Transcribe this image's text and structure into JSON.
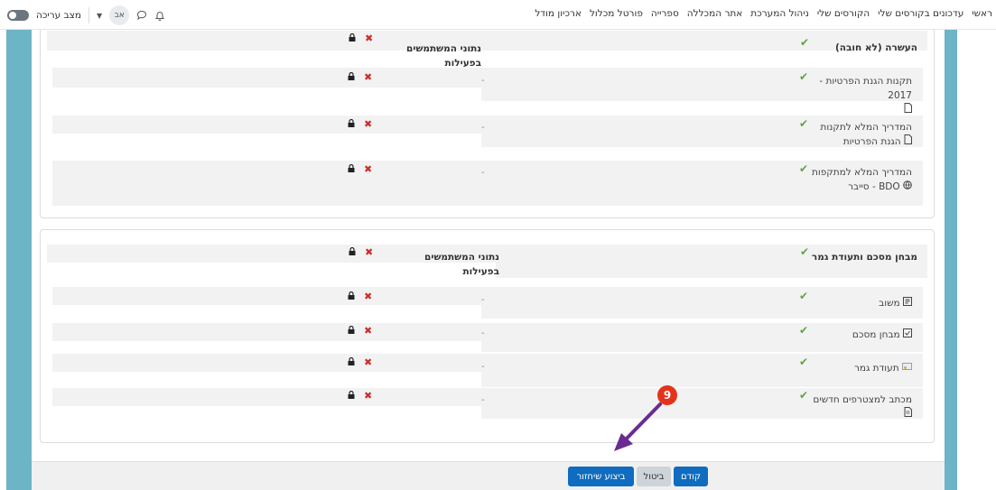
{
  "nav": {
    "links": [
      "ראשי",
      "עדכונים בקורסים שלי",
      "הקורסים שלי",
      "ניהול המערכת",
      "אתר המכללה",
      "ספרייה",
      "פורטל מכלול",
      "ארכיון מודל"
    ],
    "edit_mode_label": "מצב עריכה",
    "avatar_initials": "אב"
  },
  "section1": {
    "title": "העשרה (לא חובה)",
    "header_label": "נתוני המשתמשים בפעילות",
    "items": [
      {
        "name": "תקנות הגנת הפרטיות - 2017",
        "icon": "file-icon",
        "value": "-"
      },
      {
        "name": "המדריך המלא לתקנות הגנת הפרטיות",
        "icon": "file-icon",
        "value": "-"
      },
      {
        "name": "המדריך המלא למתקפות סייבר - BDO",
        "icon": "globe-icon",
        "value": "-"
      }
    ]
  },
  "section2": {
    "title": "מבחן מסכם ותעודת גמר",
    "header_label": "נתוני המשתמשים בפעילות",
    "items": [
      {
        "name": "משוב",
        "icon": "feedback-icon",
        "value": "-"
      },
      {
        "name": "מבחן מסכם",
        "icon": "quiz-icon",
        "value": "-"
      },
      {
        "name": "תעודת גמר",
        "icon": "certificate-icon",
        "value": "-"
      },
      {
        "name": "מכתב למצטרפים חדשים",
        "icon": "file-icon",
        "value": "-"
      }
    ]
  },
  "footer": {
    "prev_label": "קודם",
    "cancel_label": "ביטול",
    "submit_label": "ביצוע שיחזור"
  },
  "annotation": {
    "step_number": "9",
    "color": "#e5331b",
    "arrow_color": "#6a2c91"
  },
  "colors": {
    "accent": "#0f6cbf",
    "side_bar": "#6cb4c6",
    "check": "#5ea440",
    "cross": "#c9302c"
  }
}
